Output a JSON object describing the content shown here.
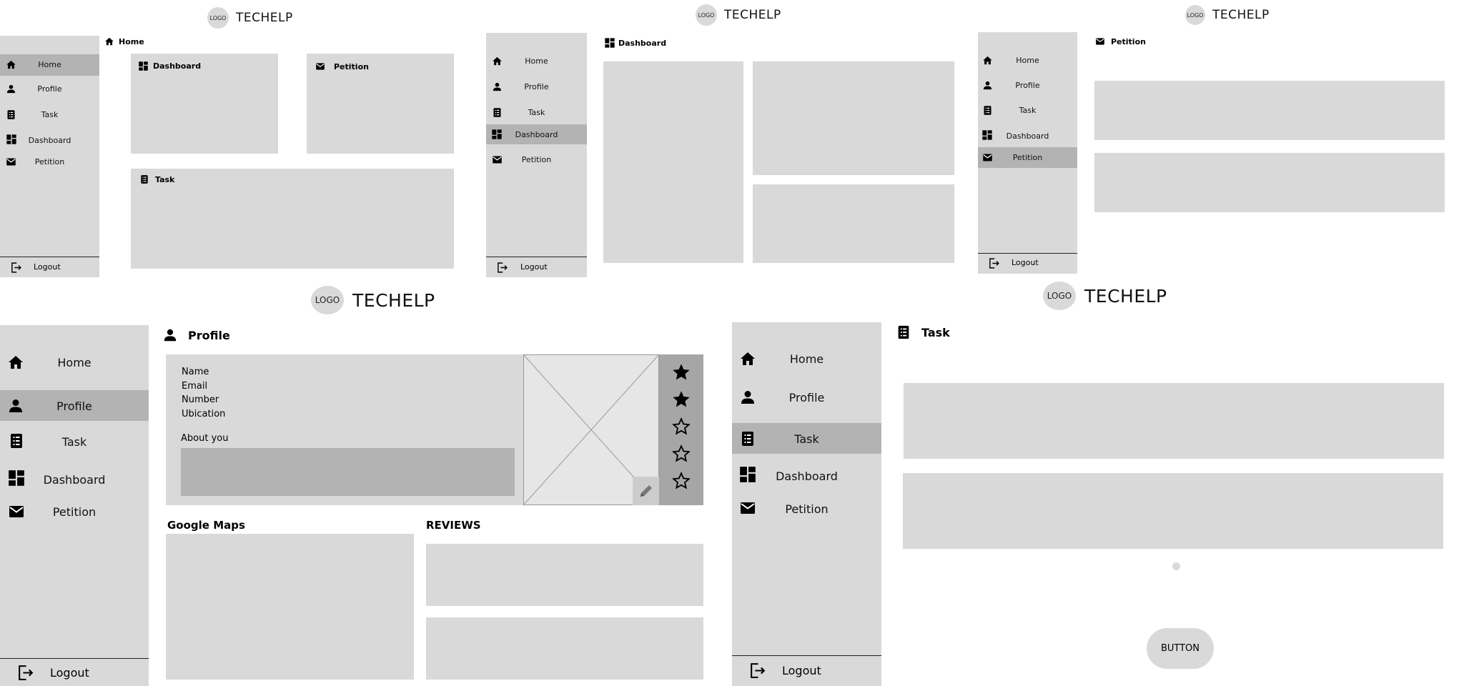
{
  "brand": {
    "logo_text": "LOGO",
    "name": "TECHELP"
  },
  "nav": {
    "home": "Home",
    "profile": "Profile",
    "task": "Task",
    "dashboard": "Dashboard",
    "petition": "Petition",
    "logout": "Logout"
  },
  "screens": {
    "home": {
      "page_title": "Home",
      "cards": {
        "dashboard": "Dashboard",
        "petition": "Petition",
        "task": "Task"
      }
    },
    "dashboard": {
      "page_title": "Dashboard"
    },
    "petition": {
      "page_title": "Petition"
    },
    "profile": {
      "page_title": "Profile",
      "fields": [
        "Name",
        "Email",
        "Number",
        "Ubication"
      ],
      "about_label": "About you",
      "rating": {
        "value": 2,
        "max": 5
      },
      "maps_title": "Google Maps",
      "reviews_title": "REVIEWS"
    },
    "task": {
      "page_title": "Task",
      "button_label": "BUTTON"
    }
  },
  "icons": [
    "home-icon",
    "person-icon",
    "clipboard-icon",
    "dashboard-icon",
    "envelope-icon",
    "logout-icon",
    "star-icon",
    "pencil-icon",
    "image-placeholder"
  ],
  "colors": {
    "panel": "#d9d9d9",
    "active": "#b3b3b3",
    "dark_panel": "#a6a6a6",
    "text": "#111111"
  }
}
